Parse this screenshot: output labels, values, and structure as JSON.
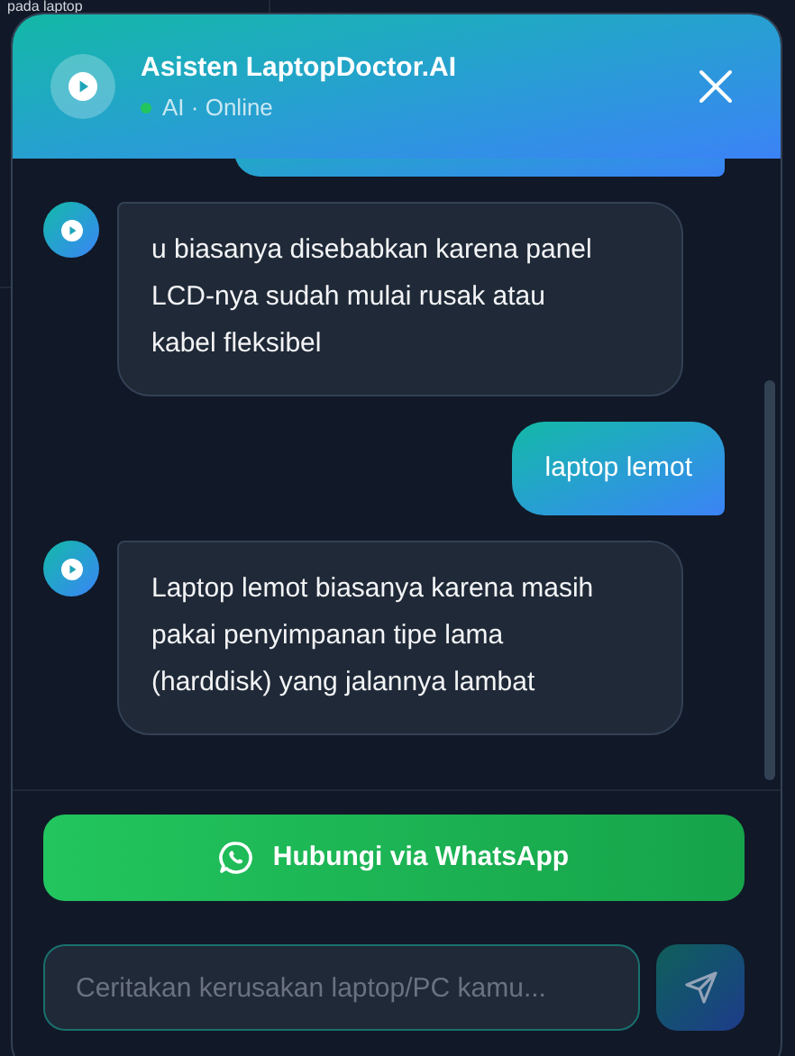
{
  "background": {
    "text": "pada laptop"
  },
  "header": {
    "title": "Asisten LaptopDoctor.AI",
    "status": "AI · Online",
    "online": true
  },
  "messages": [
    {
      "kind": "user"
    },
    {
      "kind": "bot",
      "text": "u biasanya disebabkan karena panel LCD-nya sudah mulai rusak atau kabel fleksibel"
    },
    {
      "kind": "user",
      "text": "laptop lemot"
    },
    {
      "kind": "bot",
      "text": "Laptop lemot biasanya karena masih pakai penyimpanan tipe lama (harddisk) yang jalannya lambat"
    }
  ],
  "whatsapp_button": {
    "label": "Hubungi via WhatsApp"
  },
  "input": {
    "placeholder": "Ceritakan kerusakan laptop/PC kamu..."
  }
}
